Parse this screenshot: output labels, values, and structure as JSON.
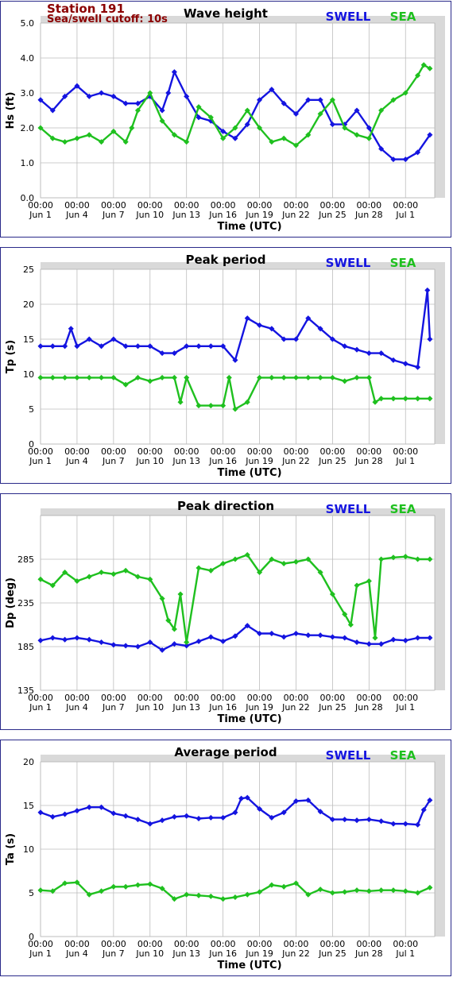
{
  "header": {
    "station": "Station 191",
    "cutoff": "Sea/swell cutoff: 10s"
  },
  "legend": {
    "swell_label": "SWELL",
    "sea_label": "SEA"
  },
  "colors": {
    "swell": "#1414e0",
    "sea": "#1fc01f",
    "plot_bg": "#ffffff",
    "frame_bg": "#d9d9d9",
    "grid": "#bdbdbd",
    "panel_border": "#2a2a8a"
  },
  "x_axis": {
    "label": "Time (UTC)",
    "time_label": "00:00",
    "ticks": [
      "Jun 1",
      "Jun 4",
      "Jun 7",
      "Jun 10",
      "Jun 13",
      "Jun 16",
      "Jun 19",
      "Jun 22",
      "Jun 25",
      "Jun 28",
      "Jul 1"
    ],
    "range_days": [
      0,
      32.4
    ],
    "grid": true
  },
  "chart_data": [
    {
      "type": "line",
      "title": "Wave height",
      "ylabel": "Hs (ft)",
      "ylim": [
        0,
        5
      ],
      "yticks": [
        "0.0",
        "1.0",
        "2.0",
        "3.0",
        "4.0",
        "5.0"
      ],
      "ytick_values": [
        0,
        1,
        2,
        3,
        4,
        5
      ],
      "series": [
        {
          "name": "SWELL",
          "color": "#1414e0",
          "x": [
            0,
            1,
            2,
            3,
            4,
            5,
            6,
            7,
            8,
            9,
            10,
            10.5,
            11,
            12,
            13,
            14,
            15,
            16,
            17,
            18,
            19,
            20,
            21,
            22,
            23,
            24,
            25,
            26,
            27,
            28,
            29,
            30,
            31,
            32
          ],
          "y": [
            2.8,
            2.5,
            2.9,
            3.2,
            2.9,
            3.0,
            2.9,
            2.7,
            2.7,
            2.9,
            2.5,
            3.0,
            3.6,
            2.9,
            2.3,
            2.2,
            1.9,
            1.7,
            2.1,
            2.8,
            3.1,
            2.7,
            2.4,
            2.8,
            2.8,
            2.1,
            2.1,
            2.5,
            2.0,
            1.4,
            1.1,
            1.1,
            1.3,
            1.8
          ]
        },
        {
          "name": "SEA",
          "color": "#1fc01f",
          "x": [
            0,
            1,
            2,
            3,
            4,
            5,
            6,
            7,
            7.5,
            8,
            9,
            10,
            11,
            12,
            13,
            14,
            15,
            16,
            17,
            18,
            19,
            20,
            21,
            22,
            23,
            24,
            25,
            26,
            27,
            28,
            29,
            30,
            31,
            31.5,
            32
          ],
          "y": [
            2.0,
            1.7,
            1.6,
            1.7,
            1.8,
            1.6,
            1.9,
            1.6,
            2.0,
            2.5,
            3.0,
            2.2,
            1.8,
            1.6,
            2.6,
            2.3,
            1.7,
            2.0,
            2.5,
            2.0,
            1.6,
            1.7,
            1.5,
            1.8,
            2.4,
            2.8,
            2.0,
            1.8,
            1.7,
            2.5,
            2.8,
            3.0,
            3.5,
            3.8,
            3.7
          ]
        }
      ]
    },
    {
      "type": "line",
      "title": "Peak period",
      "ylabel": "Tp (s)",
      "ylim": [
        0,
        25
      ],
      "yticks": [
        "0",
        "5",
        "10",
        "15",
        "20",
        "25"
      ],
      "ytick_values": [
        0,
        5,
        10,
        15,
        20,
        25
      ],
      "series": [
        {
          "name": "SWELL",
          "color": "#1414e0",
          "x": [
            0,
            1,
            2,
            2.5,
            3,
            4,
            5,
            6,
            7,
            8,
            9,
            10,
            11,
            12,
            13,
            14,
            15,
            16,
            17,
            18,
            19,
            20,
            21,
            22,
            23,
            24,
            25,
            26,
            27,
            28,
            29,
            30,
            31,
            31.8,
            32
          ],
          "y": [
            14,
            14,
            14,
            16.5,
            14,
            15,
            14,
            15,
            14,
            14,
            14,
            13,
            13,
            14,
            14,
            14,
            14,
            12,
            18,
            17,
            16.5,
            15,
            15,
            18,
            16.5,
            15,
            14,
            13.5,
            13,
            13,
            12,
            11.5,
            11,
            22,
            15
          ]
        },
        {
          "name": "SEA",
          "color": "#1fc01f",
          "x": [
            0,
            1,
            2,
            3,
            4,
            5,
            6,
            7,
            8,
            9,
            10,
            11,
            11.5,
            12,
            13,
            14,
            15,
            15.5,
            16,
            17,
            18,
            19,
            20,
            21,
            22,
            23,
            24,
            25,
            26,
            27,
            27.5,
            28,
            29,
            30,
            31,
            32
          ],
          "y": [
            9.5,
            9.5,
            9.5,
            9.5,
            9.5,
            9.5,
            9.5,
            8.5,
            9.5,
            9,
            9.5,
            9.5,
            6,
            9.5,
            5.5,
            5.5,
            5.5,
            9.5,
            5,
            6,
            9.5,
            9.5,
            9.5,
            9.5,
            9.5,
            9.5,
            9.5,
            9,
            9.5,
            9.5,
            6,
            6.5,
            6.5,
            6.5,
            6.5,
            6.5
          ]
        }
      ]
    },
    {
      "type": "line",
      "title": "Peak direction",
      "ylabel": "Dp (deg)",
      "ylim": [
        135,
        335
      ],
      "yticks": [
        "135",
        "185",
        "235",
        "285"
      ],
      "ytick_values": [
        135,
        185,
        235,
        285
      ],
      "series": [
        {
          "name": "SWELL",
          "color": "#1414e0",
          "x": [
            0,
            1,
            2,
            3,
            4,
            5,
            6,
            7,
            8,
            9,
            10,
            11,
            12,
            13,
            14,
            15,
            16,
            17,
            18,
            19,
            20,
            21,
            22,
            23,
            24,
            25,
            26,
            27,
            28,
            29,
            30,
            31,
            32
          ],
          "y": [
            192,
            195,
            193,
            195,
            193,
            190,
            187,
            186,
            185,
            190,
            181,
            188,
            186,
            191,
            196,
            191,
            197,
            209,
            200,
            200,
            196,
            200,
            198,
            198,
            196,
            195,
            190,
            188,
            188,
            193,
            192,
            195,
            195
          ]
        },
        {
          "name": "SEA",
          "color": "#1fc01f",
          "x": [
            0,
            1,
            2,
            3,
            4,
            5,
            6,
            7,
            8,
            9,
            10,
            10.5,
            11,
            11.5,
            12,
            13,
            14,
            15,
            16,
            17,
            18,
            19,
            20,
            21,
            22,
            23,
            24,
            25,
            25.5,
            26,
            27,
            27.5,
            28,
            29,
            30,
            31,
            32
          ],
          "y": [
            262,
            255,
            270,
            260,
            265,
            270,
            268,
            272,
            265,
            262,
            240,
            215,
            205,
            245,
            190,
            275,
            272,
            280,
            285,
            290,
            270,
            285,
            280,
            282,
            285,
            270,
            245,
            222,
            210,
            255,
            260,
            195,
            285,
            287,
            288,
            285,
            285
          ]
        }
      ]
    },
    {
      "type": "line",
      "title": "Average period",
      "ylabel": "Ta (s)",
      "ylim": [
        0,
        20
      ],
      "yticks": [
        "0",
        "5",
        "10",
        "15",
        "20"
      ],
      "ytick_values": [
        0,
        5,
        10,
        15,
        20
      ],
      "series": [
        {
          "name": "SWELL",
          "color": "#1414e0",
          "x": [
            0,
            1,
            2,
            3,
            4,
            5,
            6,
            7,
            8,
            9,
            10,
            11,
            12,
            13,
            14,
            15,
            16,
            16.5,
            17,
            18,
            19,
            20,
            21,
            22,
            23,
            24,
            25,
            26,
            27,
            28,
            29,
            30,
            31,
            31.5,
            32
          ],
          "y": [
            14.2,
            13.7,
            14.0,
            14.4,
            14.8,
            14.8,
            14.1,
            13.8,
            13.4,
            12.9,
            13.3,
            13.7,
            13.8,
            13.5,
            13.6,
            13.6,
            14.2,
            15.8,
            15.9,
            14.6,
            13.6,
            14.2,
            15.5,
            15.6,
            14.3,
            13.4,
            13.4,
            13.3,
            13.4,
            13.2,
            12.9,
            12.9,
            12.8,
            14.5,
            15.6
          ]
        },
        {
          "name": "SEA",
          "color": "#1fc01f",
          "x": [
            0,
            1,
            2,
            3,
            4,
            5,
            6,
            7,
            8,
            9,
            10,
            11,
            12,
            13,
            14,
            15,
            16,
            17,
            18,
            19,
            20,
            21,
            22,
            23,
            24,
            25,
            26,
            27,
            28,
            29,
            30,
            31,
            32
          ],
          "y": [
            5.3,
            5.2,
            6.1,
            6.2,
            4.8,
            5.2,
            5.7,
            5.7,
            5.9,
            6.0,
            5.5,
            4.3,
            4.8,
            4.7,
            4.6,
            4.3,
            4.5,
            4.8,
            5.1,
            5.9,
            5.7,
            6.1,
            4.8,
            5.4,
            5.0,
            5.1,
            5.3,
            5.2,
            5.3,
            5.3,
            5.2,
            5.0,
            5.6
          ]
        }
      ]
    }
  ]
}
